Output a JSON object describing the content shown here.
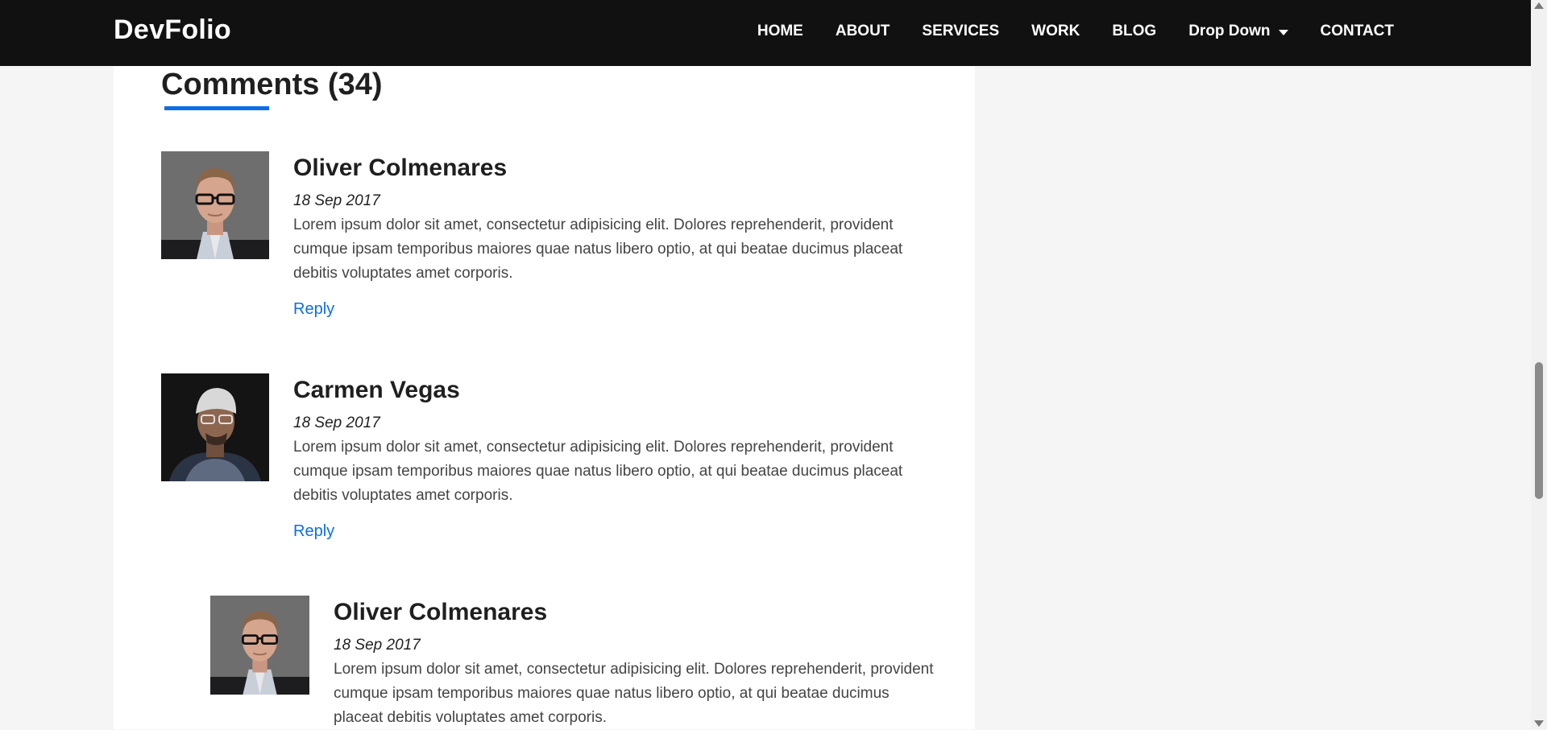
{
  "brand": "DevFolio",
  "nav": {
    "items": [
      {
        "label": "HOME"
      },
      {
        "label": "ABOUT"
      },
      {
        "label": "SERVICES"
      },
      {
        "label": "WORK"
      },
      {
        "label": "BLOG"
      },
      {
        "label": "Drop Down",
        "dropdown": true
      },
      {
        "label": "CONTACT"
      }
    ]
  },
  "comments": {
    "title": "Comments (34)",
    "items": [
      {
        "author": "Oliver Colmenares",
        "date": "18 Sep 2017",
        "text": "Lorem ipsum dolor sit amet, consectetur adipisicing elit. Dolores reprehenderit, provident cumque ipsam temporibus maiores quae natus libero optio, at qui beatae ducimus placeat debitis voluptates amet corporis.",
        "reply_label": "Reply",
        "avatar": "man-with-glasses-photo"
      },
      {
        "author": "Carmen Vegas",
        "date": "18 Sep 2017",
        "text": "Lorem ipsum dolor sit amet, consectetur adipisicing elit. Dolores reprehenderit, provident cumque ipsam temporibus maiores quae natus libero optio, at qui beatae ducimus placeat debitis voluptates amet corporis.",
        "reply_label": "Reply",
        "avatar": "man-in-beanie-photo"
      },
      {
        "author": "Oliver Colmenares",
        "date": "18 Sep 2017",
        "text": "Lorem ipsum dolor sit amet, consectetur adipisicing elit. Dolores reprehenderit, provident cumque ipsam temporibus maiores quae natus libero optio, at qui beatae ducimus placeat debitis voluptates amet corporis.",
        "avatar": "man-with-glasses-photo",
        "is_reply": true
      }
    ]
  },
  "colors": {
    "navbar_bg": "#111111",
    "accent": "#0b6ee8",
    "page_bg": "#f5f5f5",
    "card_bg": "#ffffff"
  }
}
